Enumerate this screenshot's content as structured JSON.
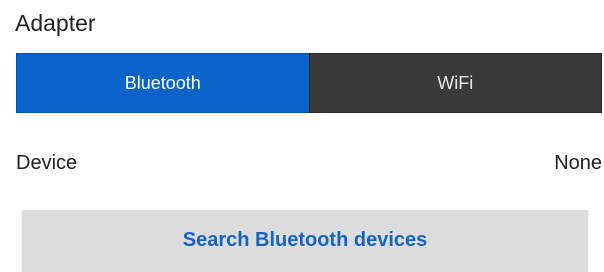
{
  "adapter": {
    "title": "Adapter",
    "options": [
      {
        "label": "Bluetooth",
        "selected": true
      },
      {
        "label": "WiFi",
        "selected": false
      }
    ],
    "colors": {
      "selected_bg": "#0a63c9",
      "unselected_bg": "#3a3a3a"
    }
  },
  "device": {
    "label": "Device",
    "value": "None"
  },
  "actions": {
    "search_label": "Search Bluetooth devices",
    "colors": {
      "button_bg": "#dcdcdc",
      "button_text": "#1764c0"
    }
  }
}
